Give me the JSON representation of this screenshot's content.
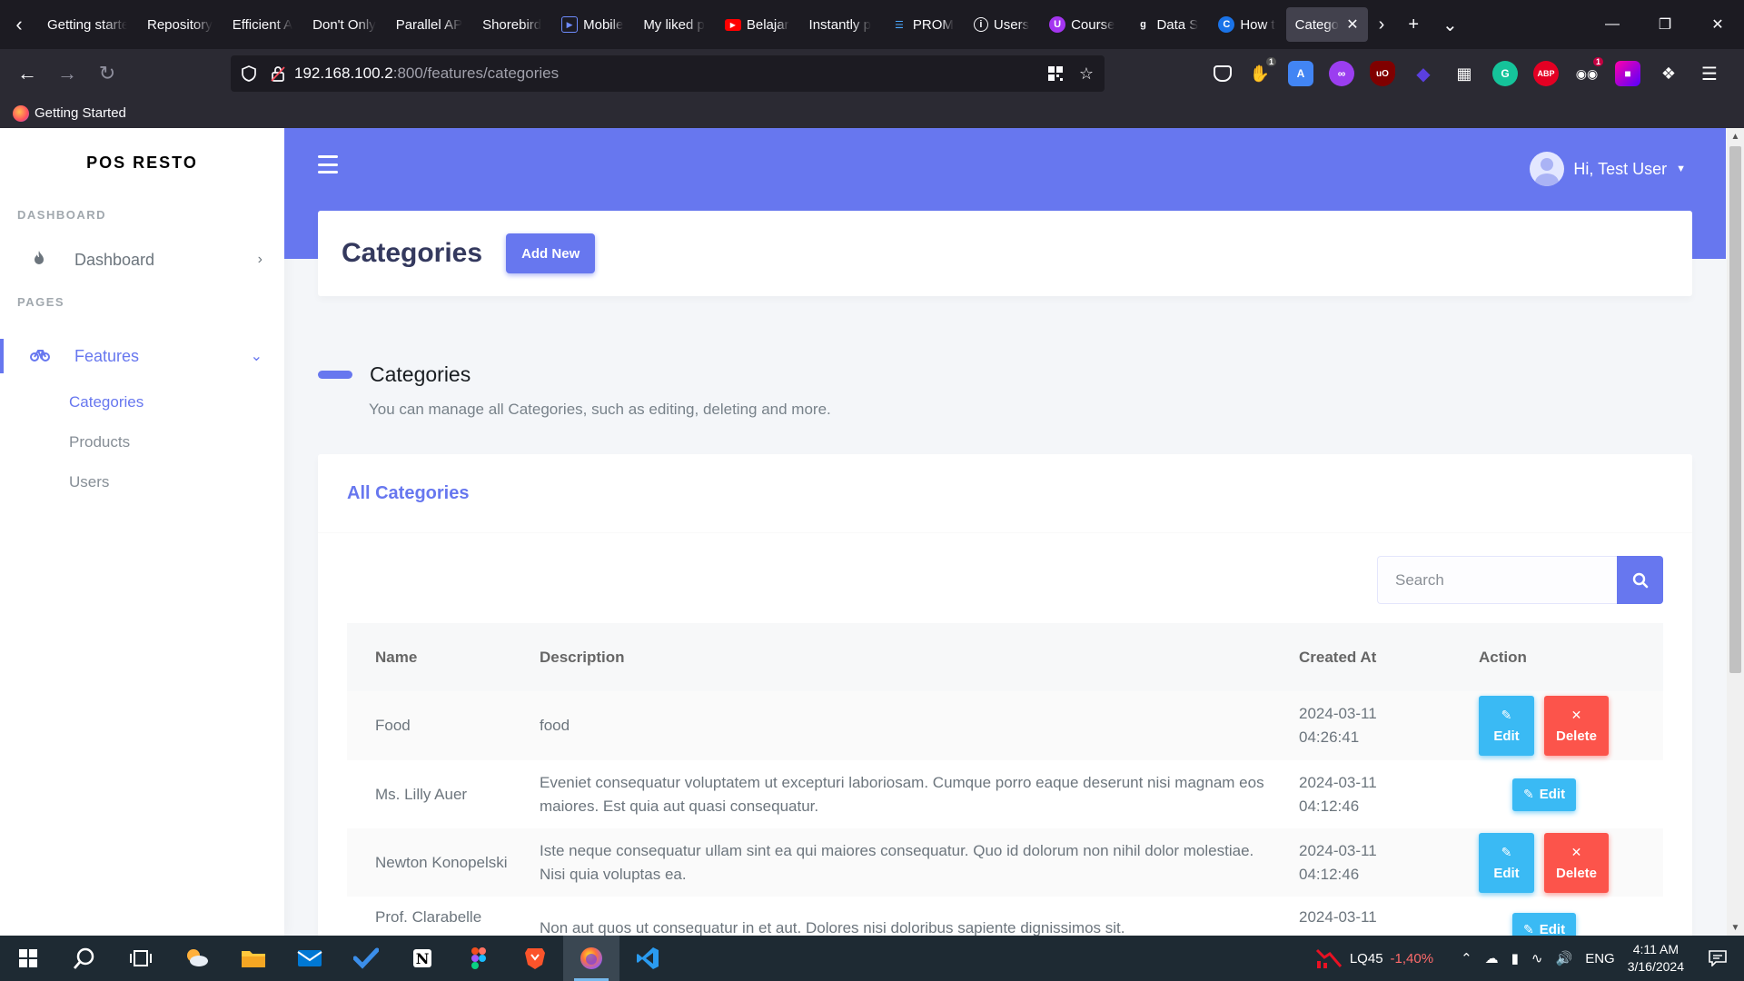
{
  "browser": {
    "tabs": [
      {
        "label": "Getting started",
        "icon": "github-icon",
        "color": "#fbfbfe"
      },
      {
        "label": "Repository",
        "icon": "github-icon",
        "color": "#fbfbfe"
      },
      {
        "label": "Efficient A",
        "icon": "github-icon",
        "color": "#fbfbfe"
      },
      {
        "label": "Don't Only",
        "icon": "github-icon",
        "color": "#fbfbfe"
      },
      {
        "label": "Parallel AP",
        "icon": "github-icon",
        "color": "#fbfbfe"
      },
      {
        "label": "Shorebird",
        "icon": "github-icon",
        "color": "#fbfbfe"
      },
      {
        "label": "Mobile",
        "icon": "play-icon",
        "color": "#6f8cff"
      },
      {
        "label": "My liked p",
        "icon": "github-icon",
        "color": "#fbfbfe"
      },
      {
        "label": "Belajar",
        "icon": "youtube-icon",
        "color": "#ff0000"
      },
      {
        "label": "Instantly p",
        "icon": "github-icon",
        "color": "#fbfbfe"
      },
      {
        "label": "PROM",
        "icon": "layers-icon",
        "color": "#4aa8ff"
      },
      {
        "label": "Users",
        "icon": "info-icon",
        "color": "#fbfbfe"
      },
      {
        "label": "Course",
        "icon": "udemy-icon",
        "color": "#a435f0"
      },
      {
        "label": "Data S",
        "icon": "g-icon",
        "color": "#fbfbfe"
      },
      {
        "label": "How t",
        "icon": "c-icon",
        "color": "#1a73e8"
      },
      {
        "label": "Categories",
        "icon": "none",
        "color": "#fbfbfe",
        "active": true
      }
    ],
    "url_host": "192.168.100.2",
    "url_path": ":800/features/categories",
    "bookmark": "Getting Started"
  },
  "app": {
    "brand": "POS RESTO",
    "menu_header_dashboard": "DASHBOARD",
    "menu_dashboard": "Dashboard",
    "menu_header_pages": "PAGES",
    "menu_features": "Features",
    "sub_categories": "Categories",
    "sub_products": "Products",
    "sub_users": "Users",
    "user_greeting": "Hi, Test User",
    "page_title": "Categories",
    "add_new": "Add New",
    "section_title": "Categories",
    "section_lead": "You can manage all Categories, such as editing, deleting and more.",
    "card_title": "All Categories",
    "search_placeholder": "Search",
    "columns": {
      "name": "Name",
      "description": "Description",
      "created_at": "Created At",
      "action": "Action"
    },
    "rows": [
      {
        "name": "Food",
        "description": "food",
        "date": "2024-03-11",
        "time": "04:26:41",
        "edit": "Edit",
        "delete": "Delete"
      },
      {
        "name": "Ms. Lilly Auer",
        "description": "Eveniet consequatur voluptatem ut excepturi laboriosam. Cumque porro eaque deserunt nisi magnam eos maiores. Est quia aut quasi consequatur.",
        "date": "2024-03-11",
        "time": "04:12:46",
        "edit": "Edit"
      },
      {
        "name": "Newton Konopelski",
        "description": "Iste neque consequatur ullam sint ea qui maiores consequatur. Quo id dolorum non nihil dolor molestiae. Nisi quia voluptas ea.",
        "date": "2024-03-11",
        "time": "04:12:46",
        "edit": "Edit",
        "delete": "Delete"
      },
      {
        "name": "Prof. Clarabelle",
        "description": "Non aut quos ut consequatur in et aut. Dolores nisi doloribus sapiente dignissimos sit.",
        "date": "2024-03-11",
        "time": "",
        "edit": "Edit"
      }
    ],
    "accent_color": "#6777ef",
    "info_color": "#3abaf4",
    "danger_color": "#fc544b"
  },
  "taskbar": {
    "stock_symbol": "LQ45",
    "stock_change": "-1,40%",
    "language": "ENG",
    "time": "4:11 AM",
    "date": "3/16/2024"
  }
}
